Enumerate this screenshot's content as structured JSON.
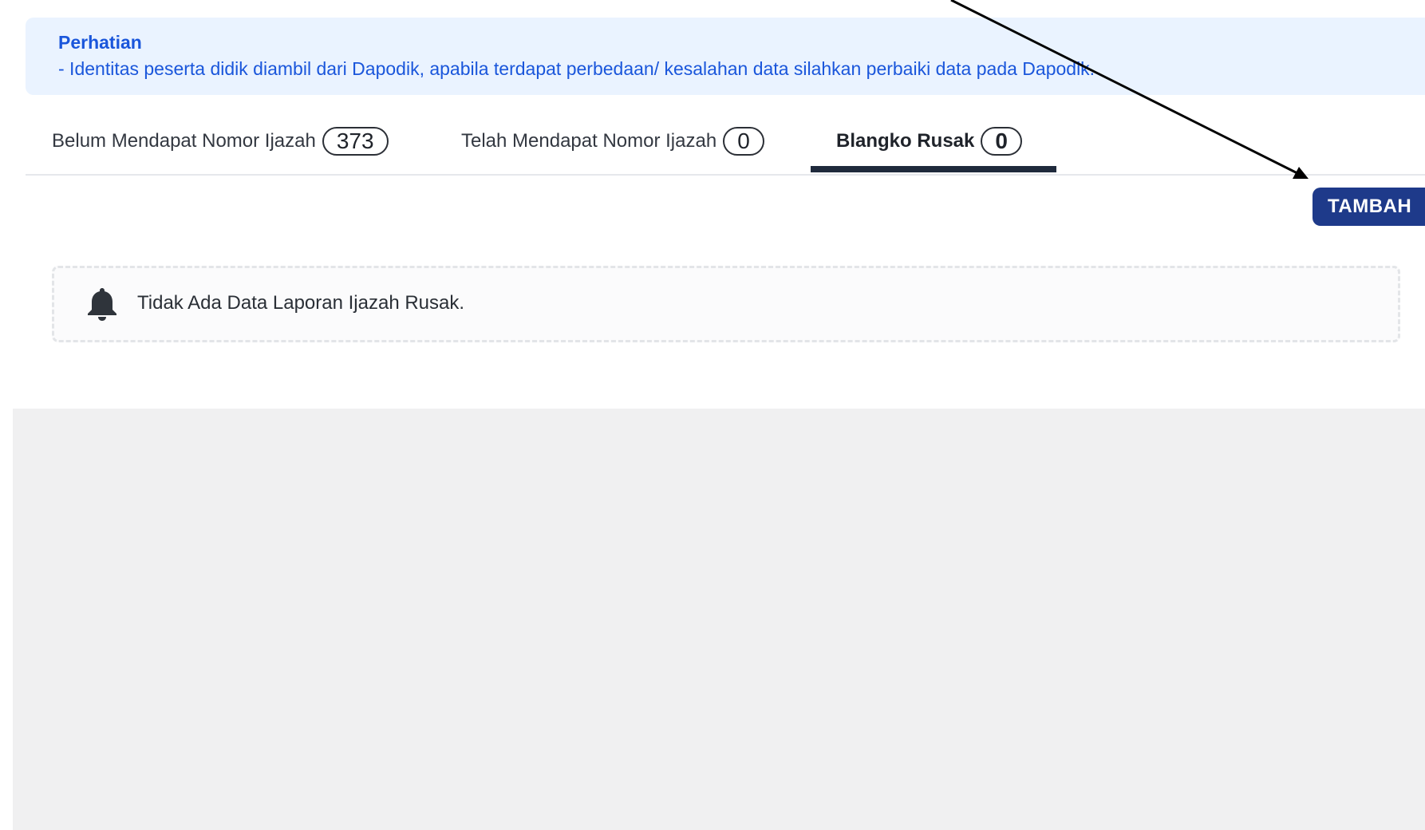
{
  "notice": {
    "title": "Perhatian",
    "text": "- Identitas peserta didik diambil dari Dapodik, apabila terdapat perbedaan/ kesalahan data silahkan perbaiki data pada Dapodik."
  },
  "tabs": [
    {
      "label": "Belum Mendapat Nomor Ijazah",
      "count": "373",
      "active": false
    },
    {
      "label": "Telah Mendapat Nomor Ijazah",
      "count": "0",
      "active": false
    },
    {
      "label": "Blangko Rusak",
      "count": "0",
      "active": true
    }
  ],
  "actions": {
    "add_label": "TAMBAH"
  },
  "empty_state": {
    "icon": "bell-icon",
    "message": "Tidak Ada Data Laporan Ijazah Rusak."
  },
  "colors": {
    "notice_text": "#1a56db",
    "notice_bg": "#eaf3ff",
    "primary_button": "#1e3a8a",
    "active_tab_indicator": "#1f2a3c"
  }
}
